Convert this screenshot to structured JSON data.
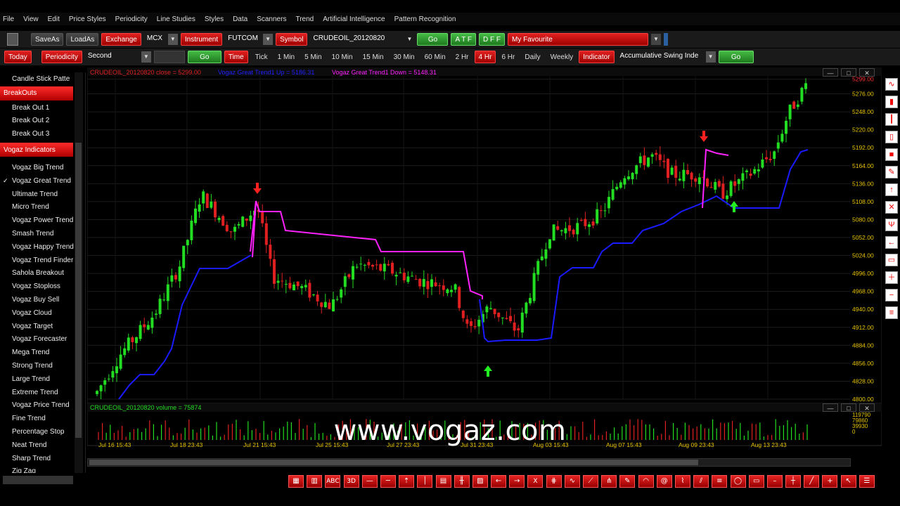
{
  "menu": [
    "File",
    "View",
    "Edit",
    "Price Styles",
    "Periodicity",
    "Line Studies",
    "Styles",
    "Data",
    "Scanners",
    "Trend",
    "Artificial Intelligence",
    "Pattern Recognition"
  ],
  "toolbar1": {
    "save_as": "SaveAs",
    "load_as": "LoadAs",
    "exchange_label": "Exchange",
    "exchange_value": "MCX",
    "instrument_label": "Instrument",
    "instrument_value": "FUTCOM",
    "symbol_label": "Symbol",
    "symbol_value": "CRUDEOIL_20120820",
    "go": "Go",
    "atf": "A T F",
    "dff": "D F F",
    "favourite": "My Favourite"
  },
  "toolbar2": {
    "today": "Today",
    "periodicity_label": "Periodicity",
    "periodicity_value": "Second",
    "go": "Go",
    "time": "Time",
    "periods": [
      "Tick",
      "1 Min",
      "5 Min",
      "10 Min",
      "15 Min",
      "30 Min",
      "60 Min",
      "2 Hr",
      "4 Hr",
      "6 Hr",
      "Daily",
      "Weekly"
    ],
    "active_period": "4 Hr",
    "indicator_label": "Indicator",
    "indicator_value": "Accumulative Swing Inde",
    "go2": "Go"
  },
  "left_panel": {
    "top_item": "Candle Stick Patte",
    "breakouts_header": "BreakOuts",
    "breakouts": [
      "Break Out 1",
      "Break Out 2",
      "Break Out 3"
    ],
    "vogaz_header": "Vogaz Indicators",
    "indicators": [
      {
        "label": "Vogaz Big Trend",
        "checked": false
      },
      {
        "label": "Vogaz Great Trend",
        "checked": true
      },
      {
        "label": "Ultimate Trend",
        "checked": false
      },
      {
        "label": "Micro Trend",
        "checked": false
      },
      {
        "label": "Vogaz Power Trend",
        "checked": false
      },
      {
        "label": "Smash Trend",
        "checked": false
      },
      {
        "label": "Vogaz Happy Trend",
        "checked": false
      },
      {
        "label": "Vogaz Trend Finder",
        "checked": false
      },
      {
        "label": "Sahola Breakout",
        "checked": false
      },
      {
        "label": "Vogaz Stoploss",
        "checked": false
      },
      {
        "label": "Vogaz Buy Sell",
        "checked": false
      },
      {
        "label": "Vogaz Cloud",
        "checked": false
      },
      {
        "label": "Vogaz Target",
        "checked": false
      },
      {
        "label": "Vogaz Forecaster",
        "checked": false
      },
      {
        "label": "Mega Trend",
        "checked": false
      },
      {
        "label": "Strong Trend",
        "checked": false
      },
      {
        "label": "Large Trend",
        "checked": false
      },
      {
        "label": "Extreme Trend",
        "checked": false
      },
      {
        "label": "Vogaz Price Trend",
        "checked": false
      },
      {
        "label": "Fine Trend",
        "checked": false
      },
      {
        "label": "Percentage Stop",
        "checked": false
      },
      {
        "label": "Neat Trend",
        "checked": false
      },
      {
        "label": "Sharp Trend",
        "checked": false
      },
      {
        "label": "Zig Zag",
        "checked": false
      }
    ]
  },
  "chart_data": {
    "type": "candlestick",
    "legend": {
      "close": "CRUDEOIL_20120820 close = 5299.00",
      "up": "Vogaz Great Trend1 Up = 5186.31",
      "down": "Vogaz Great Trend1 Down = 5148.31"
    },
    "volume_legend": "CRUDEOIL_20120820 volume = 75874",
    "price_axis": [
      "5299.00",
      "5276.00",
      "5248.00",
      "5220.00",
      "5192.00",
      "5164.00",
      "5136.00",
      "5108.00",
      "5080.00",
      "5052.00",
      "5024.00",
      "4996.00",
      "4968.00",
      "4940.00",
      "4912.00",
      "4884.00",
      "4856.00",
      "4828.00",
      "4800.00"
    ],
    "volume_axis": [
      "119790",
      "79860",
      "39930",
      "0"
    ],
    "x_axis": [
      "Jul 16 15:43",
      "Jul 18 23:43",
      "Jul 21 15:43",
      "Jul 25 15:43",
      "Jul 27 23:43",
      "Jul 31 23:43",
      "Aug 03 15:43",
      "Aug 07 15:43",
      "Aug 09 23:43",
      "Aug 13 23:43"
    ],
    "ylim": [
      4800,
      5304
    ],
    "colors": {
      "up": "#22dd22",
      "down": "#e02020",
      "trend_up": "#1a1aff",
      "trend_down": "#ff22ff",
      "axis_text": "#e6c200"
    }
  },
  "watermark": "www.vogaz.com",
  "bottom_tools": [
    "grid-icon",
    "bars-icon",
    "ABC",
    "3D",
    "minus-red-icon",
    "hline-icon",
    "up-arrow-icon",
    "vline-icon",
    "table-icon",
    "ticks-icon",
    "hatch-icon",
    "left-arrow-icon",
    "right-arrow-icon",
    "X",
    "fib-icon",
    "wave-icon",
    "fan-icon",
    "pitch-icon",
    "pencil-icon",
    "arc-icon",
    "spiral-icon",
    "brush-icon",
    "channel-icon",
    "lines-icon",
    "ellipse-icon",
    "rect-icon",
    "dash-icon",
    "cross-vline-icon",
    "diag-icon",
    "plus-icon",
    "cursor-icon",
    "menu-icon"
  ],
  "right_tools": [
    "wave-icon",
    "candle-icon",
    "bar-icon",
    "candle2-icon",
    "box-icon",
    "pen-icon",
    "up-icon",
    "x-icon",
    "trident-icon",
    "left-icon",
    "rect-icon",
    "plus-icon",
    "minus-icon",
    "list-icon"
  ]
}
